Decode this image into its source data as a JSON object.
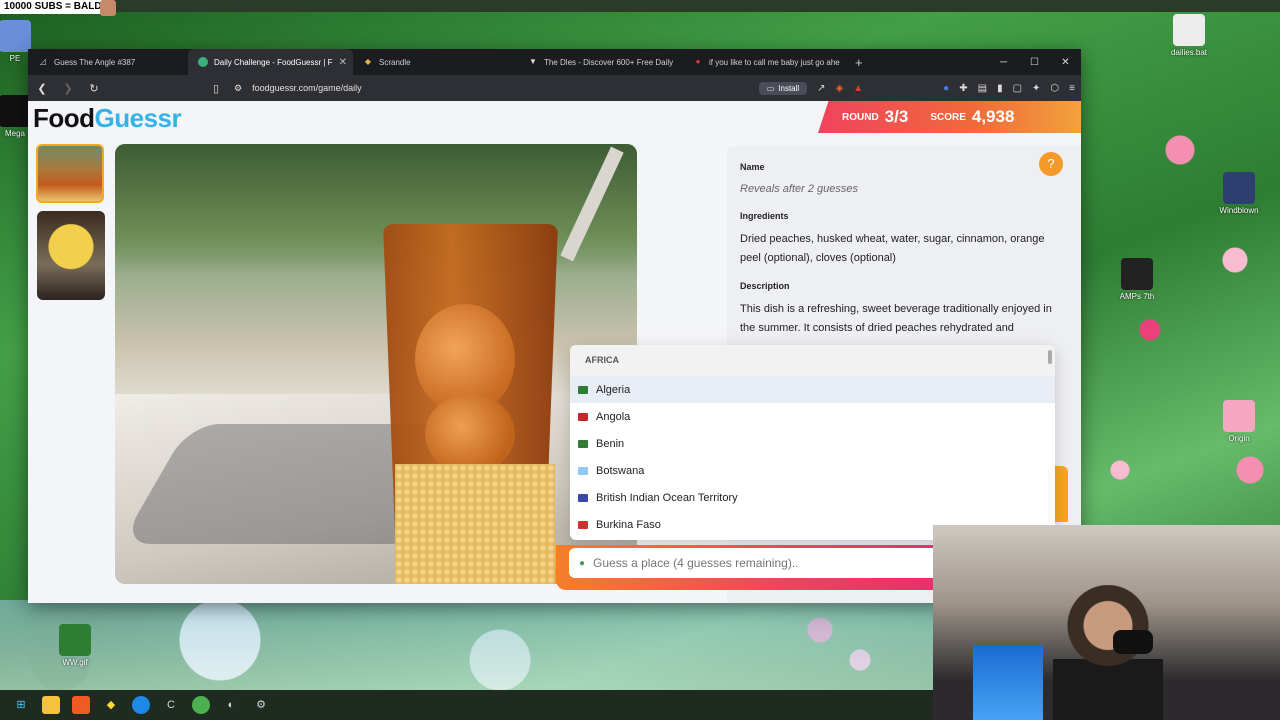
{
  "overlay": {
    "banner": "10000 SUBS = BALD"
  },
  "desktop": {
    "icons": [
      {
        "label": "PE"
      },
      {
        "label": "Mega"
      },
      {
        "label": "dailies.bat"
      },
      {
        "label": "Windblown"
      },
      {
        "label": "AMPs 7th"
      },
      {
        "label": "Origin"
      },
      {
        "label": "WW.gif"
      }
    ]
  },
  "browser": {
    "tabs": [
      {
        "label": "Guess The Angle #387",
        "active": false
      },
      {
        "label": "Daily Challenge - FoodGuessr | F",
        "active": true
      },
      {
        "label": "Scrandle",
        "active": false
      },
      {
        "label": "The Dles - Discover 600+ Free Daily",
        "active": false
      },
      {
        "label": "if you like to call me baby just go ahe",
        "active": false
      }
    ],
    "new_tab": "+",
    "url": "foodguessr.com/game/daily",
    "install_label": "Install",
    "window_controls": {
      "minimize": "─",
      "maximize": "☐",
      "close": "✕"
    }
  },
  "app": {
    "logo": {
      "part1": "Food",
      "part2": "Guessr"
    },
    "round_label": "ROUND",
    "round_value": "3/3",
    "score_label": "SCORE",
    "score_value": "4,938",
    "panel": {
      "name_label": "Name",
      "name_value": "Reveals after 2 guesses",
      "ingredients_label": "Ingredients",
      "ingredients_value": "Dried peaches, husked wheat, water, sugar, cinnamon, orange peel (optional), cloves (optional)",
      "description_label": "Description",
      "description_value": "This dish is a refreshing, sweet beverage traditionally enjoyed in the summer. It consists of dried peaches rehydrated and"
    },
    "dropdown": {
      "region": "AFRICA",
      "options": [
        "Algeria",
        "Angola",
        "Benin",
        "Botswana",
        "British Indian Ocean Territory",
        "Burkina Faso"
      ],
      "flag_colors": [
        "#2e7d32",
        "#c62828",
        "#2e7d32",
        "#90caf9",
        "#3949ab",
        "#d32f2f"
      ]
    },
    "guess_input": {
      "placeholder": "Guess a place (4 guesses remaining).."
    },
    "help_icon": "?"
  }
}
